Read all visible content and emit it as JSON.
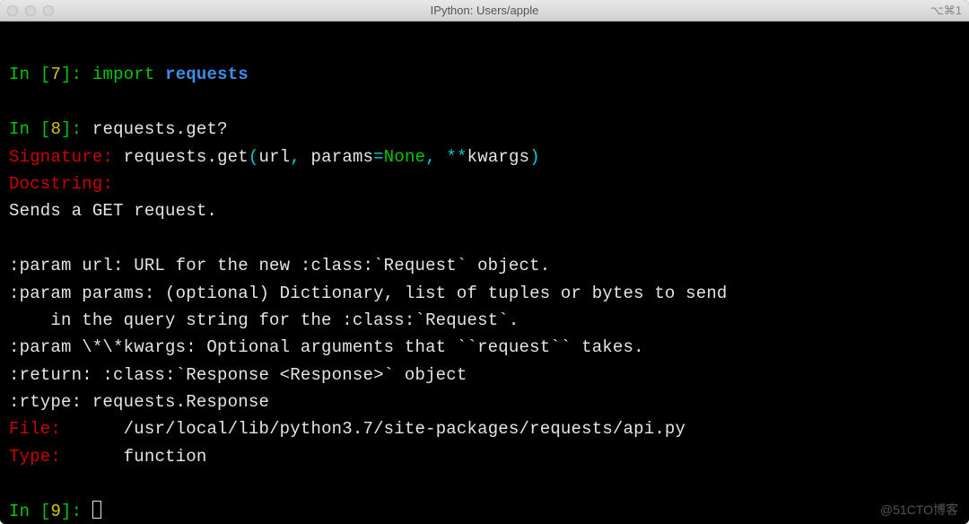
{
  "titlebar": {
    "title": "IPython: Users/apple",
    "shortcut": "⌥⌘1"
  },
  "prompt": {
    "in_label": "In",
    "num7": "7",
    "num8": "8",
    "num9": "9"
  },
  "cell7": {
    "import_kw": "import",
    "module": "requests"
  },
  "cell8": {
    "code": "requests.get?"
  },
  "help": {
    "signature_label": "Signature:",
    "sig_prefix": "requests",
    "sig_dot": ".",
    "sig_fn": "get",
    "sig_lparen": "(",
    "sig_arg1": "url",
    "sig_comma1": ",",
    "sig_arg2": "params",
    "sig_eq": "=",
    "sig_none": "None",
    "sig_comma2": ",",
    "sig_stars": "**",
    "sig_kwargs": "kwargs",
    "sig_rparen": ")",
    "docstring_label": "Docstring:",
    "doc_line1": "Sends a GET request.",
    "doc_line2": ":param url: URL for the new :class:`Request` object.",
    "doc_line3": ":param params: (optional) Dictionary, list of tuples or bytes to send",
    "doc_line4": "    in the query string for the :class:`Request`.",
    "doc_line5": ":param \\*\\*kwargs: Optional arguments that ``request`` takes.",
    "doc_line6": ":return: :class:`Response <Response>` object",
    "doc_line7": ":rtype: requests.Response",
    "file_label": "File:",
    "file_value": "/usr/local/lib/python3.7/site-packages/requests/api.py",
    "type_label": "Type:",
    "type_value": "function"
  },
  "watermark": "@51CTO博客"
}
